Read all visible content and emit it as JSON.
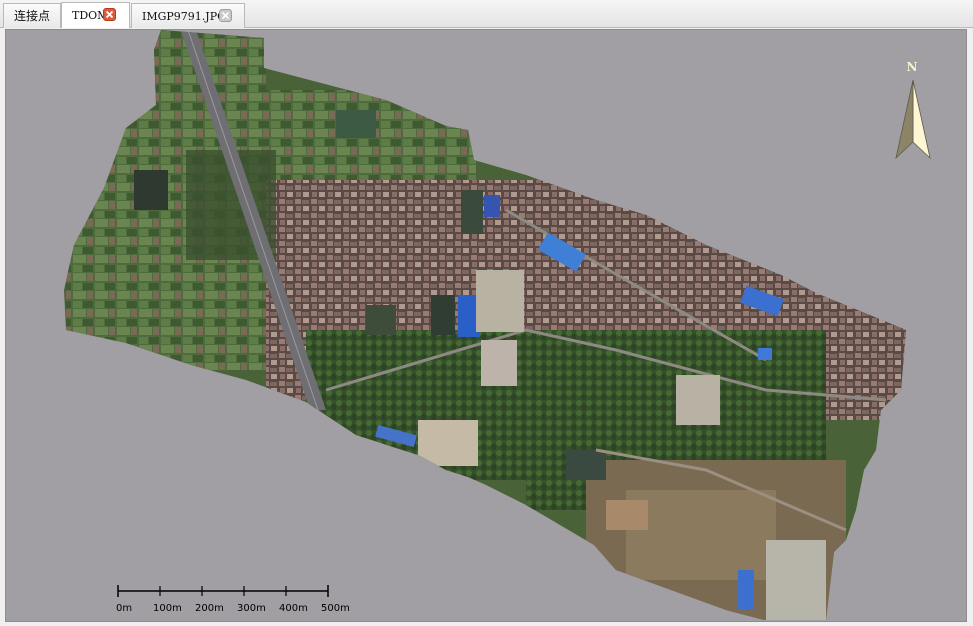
{
  "tabs": [
    {
      "label": "连接点",
      "active": false,
      "closable": false
    },
    {
      "label": "TDOM",
      "active": true,
      "closable": true,
      "close_color": "#e05a3a"
    },
    {
      "label": "IMGP9791.JPG",
      "active": false,
      "closable": true,
      "close_color": "#c9c9c9"
    }
  ],
  "viewport": {
    "background": "#a19fa3",
    "north_arrow": {
      "label": "N",
      "icon": "north-arrow-icon"
    },
    "scale_bar": {
      "ticks": [
        "0m",
        "100m",
        "200m",
        "300m",
        "400m",
        "500m"
      ]
    }
  }
}
